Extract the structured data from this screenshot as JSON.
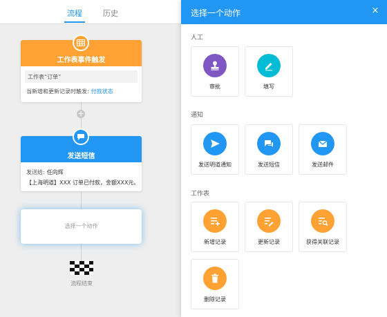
{
  "tabs": {
    "flow": "流程",
    "history": "历史"
  },
  "trigger_card": {
    "title": "工作表事件触发",
    "table_label": "工作表“订单”",
    "condition_prefix": "当新增和更新记录时触发:",
    "condition_field": "付款状态",
    "color": "#ffa233",
    "icon": "table-icon"
  },
  "sms_card": {
    "title": "发送短信",
    "to_label": "发送给:",
    "to_value": "任向辉",
    "body": "【上海明道】XXX 订单已付款，金额XXX元。",
    "color": "#2196f3",
    "icon": "chat-icon"
  },
  "select_card": {
    "text": "选择一个动作"
  },
  "end_label": "流程结束",
  "panel": {
    "title": "选择一个动作",
    "close": "×",
    "sections": {
      "manual": {
        "title": "人工",
        "items": [
          {
            "label": "审批",
            "icon": "stamp-icon",
            "color": "#7e57c2"
          },
          {
            "label": "填写",
            "icon": "pencil-icon",
            "color": "#00bcd4"
          }
        ]
      },
      "notify": {
        "title": "通知",
        "items": [
          {
            "label": "发送明道通知",
            "icon": "send-icon",
            "color": "#2196f3"
          },
          {
            "label": "发送短信",
            "icon": "chat-icon",
            "color": "#2196f3"
          },
          {
            "label": "发送邮件",
            "icon": "mail-icon",
            "color": "#2196f3"
          }
        ]
      },
      "sheet": {
        "title": "工作表",
        "items": [
          {
            "label": "新增记录",
            "icon": "list-add-icon",
            "color": "#ffa233"
          },
          {
            "label": "更新记录",
            "icon": "list-edit-icon",
            "color": "#ffa233"
          },
          {
            "label": "获得关联记录",
            "icon": "list-search-icon",
            "color": "#ffa233"
          },
          {
            "label": "删除记录",
            "icon": "trash-icon",
            "color": "#ffa233"
          }
        ]
      }
    }
  }
}
